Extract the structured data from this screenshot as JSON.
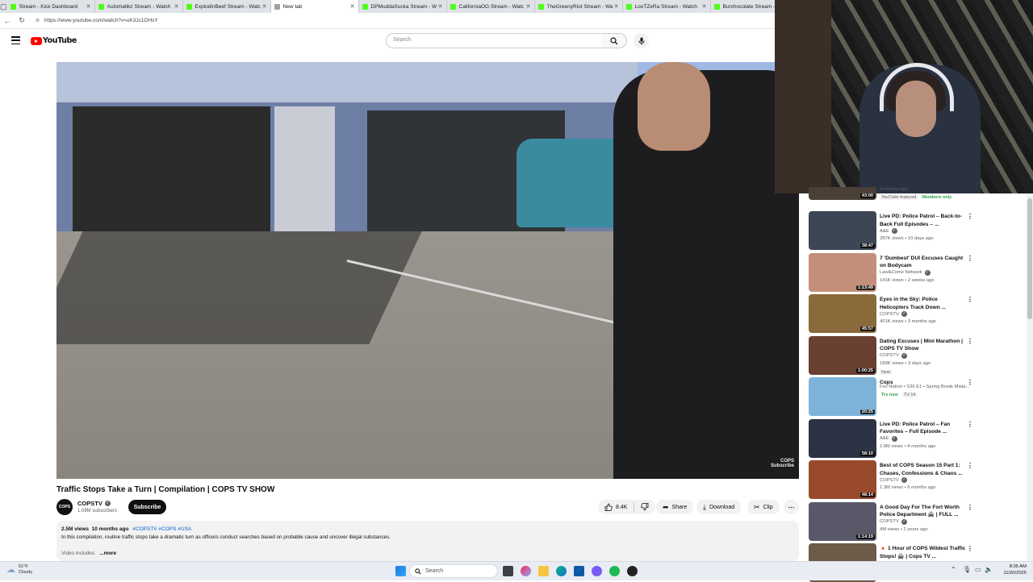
{
  "browser": {
    "tabs": [
      {
        "title": "Stream - Kick Dashboard",
        "color": "#53fc18"
      },
      {
        "title": "Automatikz Stream - Watch",
        "color": "#53fc18"
      },
      {
        "title": "ExplodinBeef Stream - Watch",
        "color": "#53fc18"
      },
      {
        "title": "New tab",
        "color": "#9aa0a6"
      },
      {
        "title": "DPMuddaSucka Stream - W",
        "color": "#53fc18"
      },
      {
        "title": "CaliforniaOG Stream - Watc",
        "color": "#53fc18"
      },
      {
        "title": "TheGreenyRiot Stream - Wa",
        "color": "#53fc18"
      },
      {
        "title": "LooTZeRa Stream - Watch",
        "color": "#53fc18"
      },
      {
        "title": "Burchocolate Stream - Watc",
        "color": "#53fc18"
      }
    ],
    "url": "https://www.youtube.com/watch?v=uK3Jc1OHsY"
  },
  "youtube": {
    "logo_text": "YouTube",
    "search_placeholder": "Search"
  },
  "video": {
    "title": "Traffic Stops Take a Turn | Compilation | COPS TV SHOW",
    "watermark": "COPS",
    "watermark_sub": "Subscribe",
    "channel": {
      "name": "COPSTV",
      "avatar_text": "COPS",
      "subscribers": "1.09M subscribers",
      "subscribe_label": "Subscribe"
    },
    "actions": {
      "likes": "8.4K",
      "share": "Share",
      "download": "Download",
      "clip": "Clip"
    },
    "description": {
      "views": "2.5M views",
      "age": "10 months ago",
      "tags": "#COPSTV #COPS #USA",
      "text": "In this compilation, routine traffic stops take a dramatic turn as officers conduct searches based on probable cause and uncover illegal substances.",
      "preview": "Video includes:",
      "more": "...more"
    }
  },
  "sidebar": {
    "partial_top": {
      "views": "4 months ago",
      "duration": "43:00",
      "badge1": "YouTube featured",
      "badge2": "Members only"
    },
    "recommendations": [
      {
        "title": "Live PD: Police Patrol – Back-to-Back Full Episodes – ...",
        "channel": "A&E",
        "views": "287K views • 10 days ago",
        "duration": "38:47",
        "thumb": "#3d4654"
      },
      {
        "title": "7 'Dumbest' DUI Excuses Caught on Bodycam",
        "channel": "Law&Crime Network",
        "views": "141K views • 2 weeks ago",
        "duration": "1:13:49",
        "thumb": "#c48f7a"
      },
      {
        "title": "Eyes in the Sky: Police Helicopters Track Down ...",
        "channel": "COPSTV",
        "views": "401K views • 3 months ago",
        "duration": "45:57",
        "thumb": "#8a6a3a"
      },
      {
        "title": "Dating Excuses | Mini Marathon | COPS TV Show",
        "channel": "COPSTV",
        "views": "189K views • 3 days ago",
        "duration": "1:00:25",
        "thumb": "#6a4030",
        "badge": "New"
      },
      {
        "title": "Cops",
        "channel": "Fox Nation • S36 E1 • Spring Break Mista...",
        "views": "",
        "duration": "20:25",
        "thumb": "#7fb2d8",
        "badge": "Try now",
        "badge2": "TV-14"
      },
      {
        "title": "Live PD: Police Patrol – Fan Favorites – Full Episode ...",
        "channel": "A&E",
        "views": "2.9M views • 4 months ago",
        "duration": "58:10",
        "thumb": "#2b3344"
      },
      {
        "title": "Best of COPS Season 15 Part 1: Chases, Confessions & Chaos ...",
        "channel": "COPSTV",
        "views": "1.3M views • 6 months ago",
        "duration": "48:14",
        "thumb": "#9a4a2c"
      },
      {
        "title": "A Good Day For The Fort Worth Police Department 🚔 | FULL ...",
        "channel": "COPSTV",
        "views": "4M views • 2 years ago",
        "duration": "1:14:19",
        "thumb": "#5a5868"
      },
      {
        "title": "🔺 1 Hour of COPS Wildest Traffic Stops! 🚔 | Cops TV ...",
        "channel": "",
        "views": "",
        "duration": "",
        "thumb": "#6e5a48"
      }
    ]
  },
  "taskbar": {
    "weather_temp": "51°F",
    "weather_desc": "Cloudy",
    "search": "Search",
    "time": "8:35 AM",
    "date": "11/20/2025"
  }
}
